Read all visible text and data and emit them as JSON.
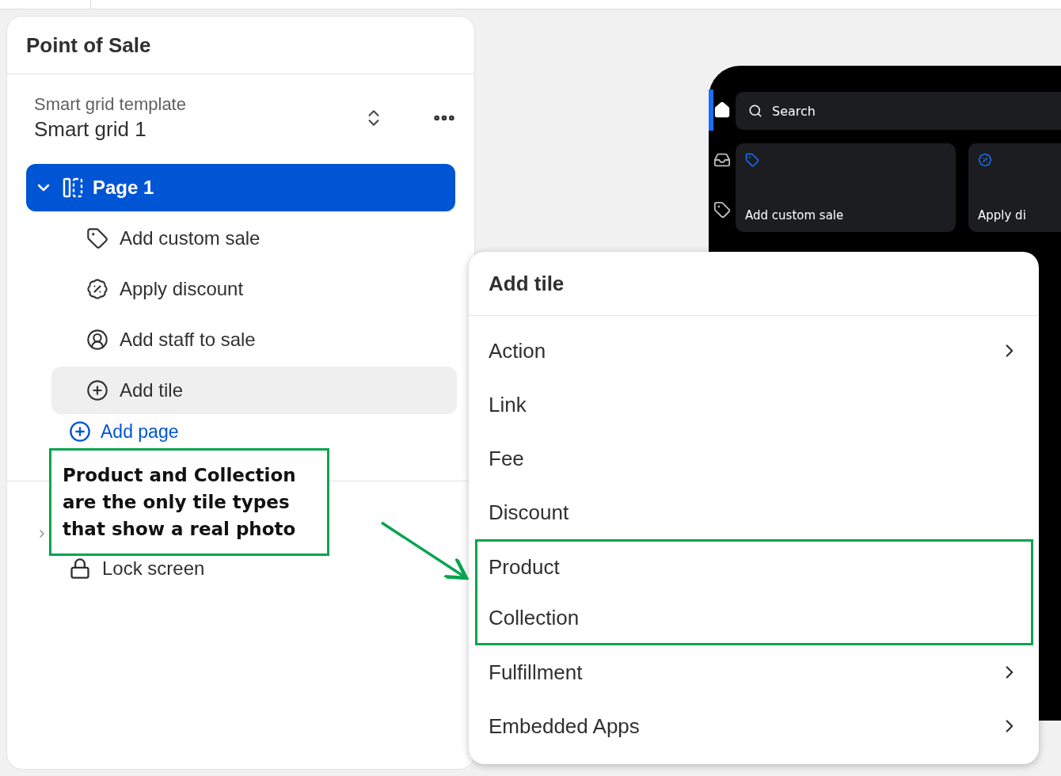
{
  "panel": {
    "title": "Point of Sale",
    "template": {
      "label": "Smart grid template",
      "value": "Smart grid 1"
    },
    "page": {
      "label": "Page 1",
      "expanded": true,
      "selected": true
    },
    "tiles": [
      {
        "label": "Add custom sale",
        "selected": false
      },
      {
        "label": "Apply discount",
        "selected": false
      },
      {
        "label": "Add staff to sale",
        "selected": false
      },
      {
        "label": "Add tile",
        "selected": true
      }
    ],
    "add_page": "Add page",
    "hidden_section": {
      "expanded": false
    },
    "lock_screen": "Lock screen"
  },
  "preview": {
    "nav": [
      {
        "selected": true
      },
      {
        "selected": false
      },
      {
        "selected": false
      }
    ],
    "search": {
      "placeholder": "Search"
    },
    "tiles": [
      "Add custom sale",
      "Apply di"
    ]
  },
  "menu": {
    "title": "Add tile",
    "items": [
      {
        "label": "Action",
        "submenu": true,
        "highlighted": false
      },
      {
        "label": "Link",
        "submenu": false,
        "highlighted": false
      },
      {
        "label": "Fee",
        "submenu": false,
        "highlighted": false
      },
      {
        "label": "Discount",
        "submenu": false,
        "highlighted": false
      },
      {
        "label": "Product",
        "submenu": false,
        "highlighted": true
      },
      {
        "label": "Collection",
        "submenu": false,
        "highlighted": true
      },
      {
        "label": "Fulfillment",
        "submenu": true,
        "highlighted": false
      },
      {
        "label": "Embedded Apps",
        "submenu": true,
        "highlighted": false
      }
    ]
  },
  "annotation": {
    "lines": [
      "Product and Collection",
      "are the only tile types",
      "that show a real photo"
    ]
  }
}
